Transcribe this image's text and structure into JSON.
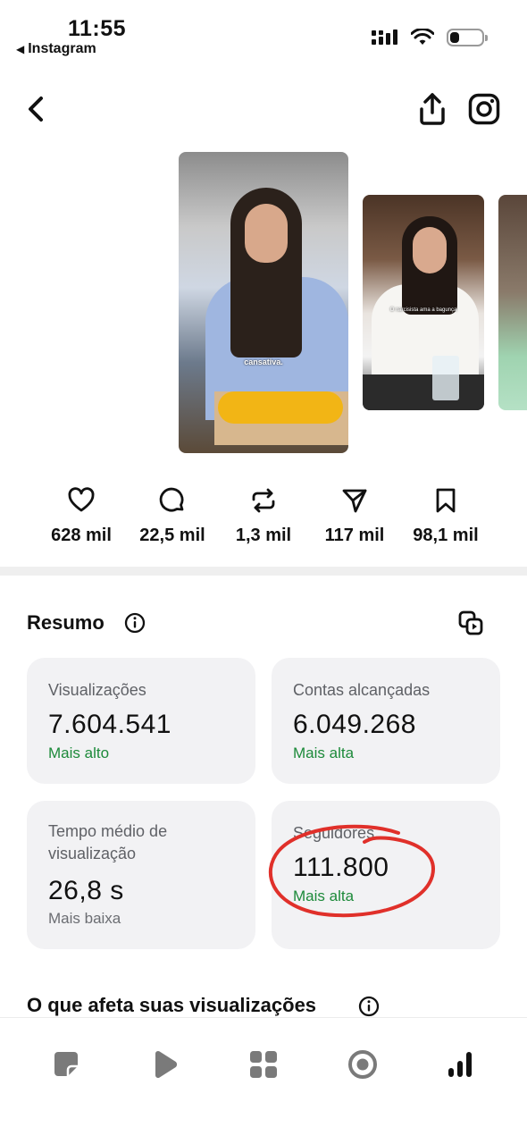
{
  "status_bar": {
    "time": "11:55",
    "back_app": "Instagram",
    "back_arrow": "◀",
    "icons": [
      "signal-icon",
      "wifi-icon",
      "battery-icon"
    ],
    "battery_level": 0.3
  },
  "header": {
    "icons": [
      "back-chevron-icon",
      "share-icon",
      "instagram-icon"
    ]
  },
  "thumbnails": {
    "main_caption": "cansativa.",
    "second_caption": "O narcisista ama a bagunça"
  },
  "engagement": [
    {
      "icon": "heart-icon",
      "value": "628 mil"
    },
    {
      "icon": "comment-icon",
      "value": "22,5 mil"
    },
    {
      "icon": "repost-icon",
      "value": "1,3 mil"
    },
    {
      "icon": "send-icon",
      "value": "117 mil"
    },
    {
      "icon": "bookmark-icon",
      "value": "98,1 mil"
    }
  ],
  "summary": {
    "title": "Resumo",
    "cards": [
      {
        "label": "Visualizações",
        "value": "7.604.541",
        "trend": "Mais alto"
      },
      {
        "label": "Contas alcançadas",
        "value": "6.049.268",
        "trend": "Mais alta"
      },
      {
        "label_line1": "Tempo médio de",
        "label_line2": "visualização",
        "value": "26,8 s",
        "trend": "Mais baixa"
      },
      {
        "label": "Seguidores",
        "value": "111.800",
        "trend": "Mais alta"
      }
    ],
    "colors": {
      "positive": "#1d8a3a",
      "neutral": "#6b6d72",
      "highlight_circle": "#e0302a"
    }
  },
  "section2": {
    "title": "O que afeta suas visualizações"
  },
  "tabbar": {
    "tabs": [
      "post-icon",
      "reels-icon",
      "grid-icon",
      "target-icon",
      "insights-icon"
    ],
    "active": "insights-icon"
  }
}
